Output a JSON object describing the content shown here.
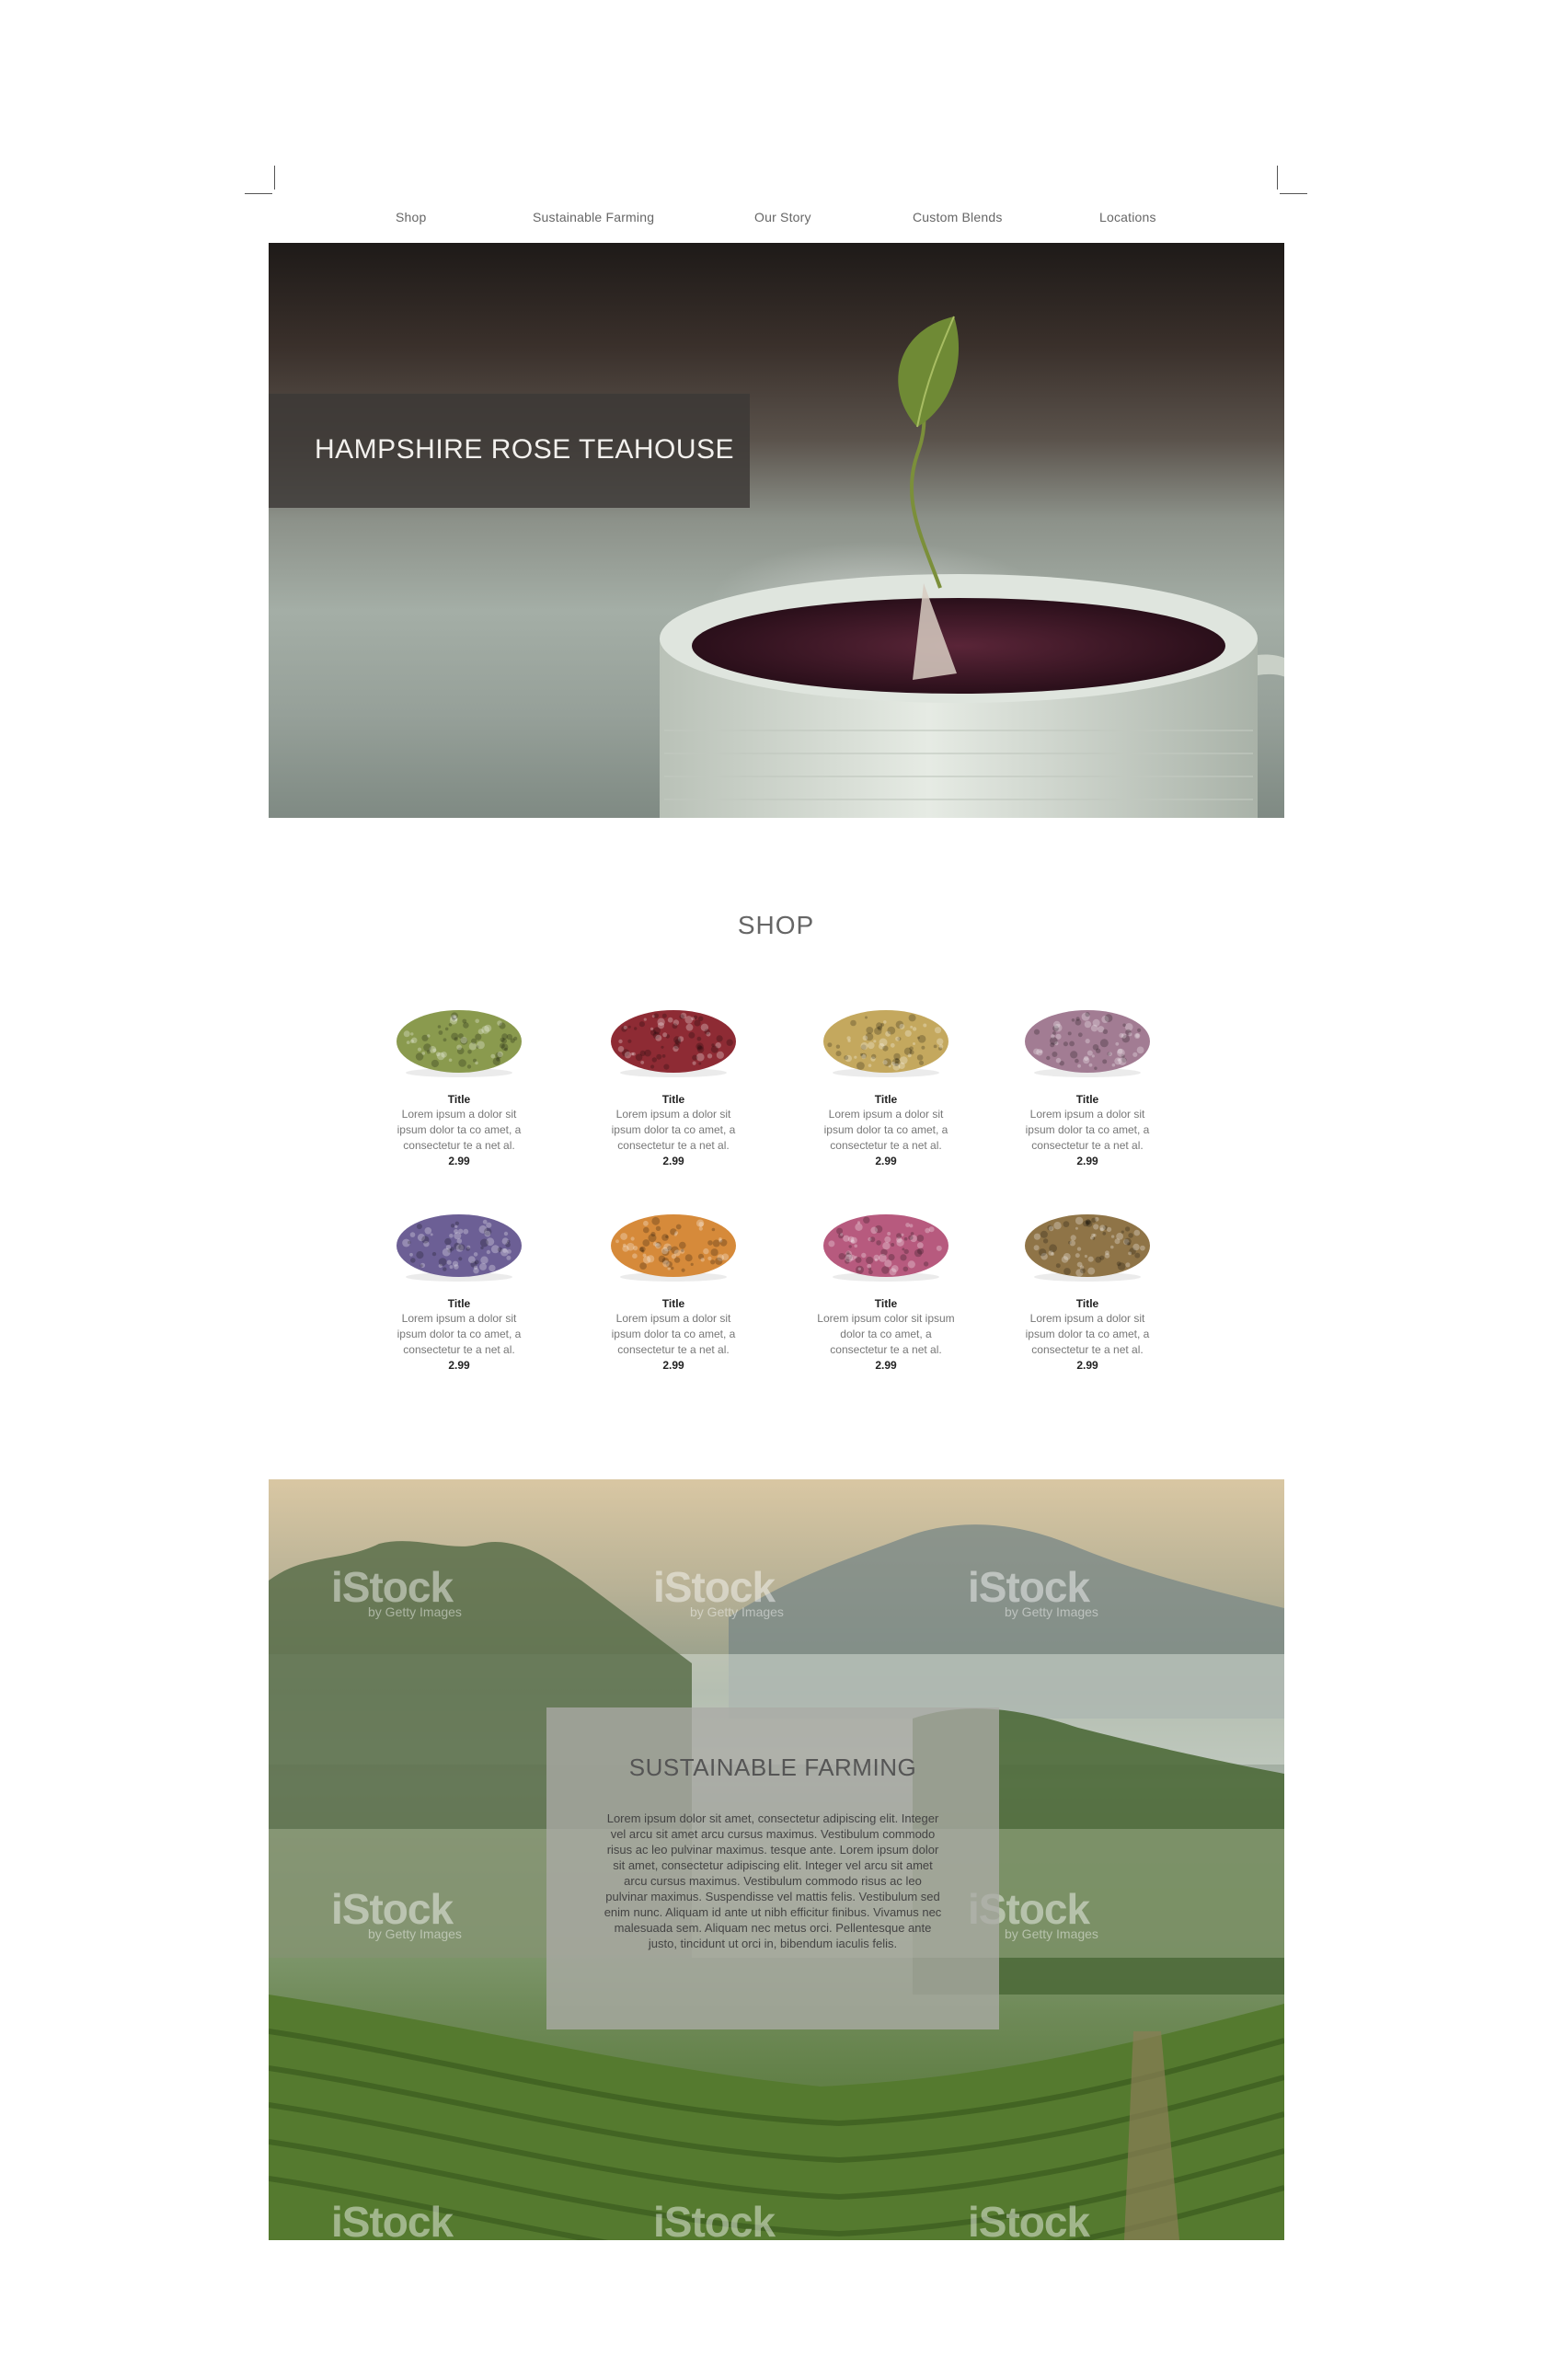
{
  "nav": {
    "items": [
      {
        "label": "Shop"
      },
      {
        "label": "Sustainable Farming"
      },
      {
        "label": "Our Story"
      },
      {
        "label": "Custom Blends"
      },
      {
        "label": "Locations"
      }
    ]
  },
  "hero": {
    "title": "HAMPSHIRE ROSE TEAHOUSE",
    "image": "tea-cup-with-leaf-tea-bag"
  },
  "shop": {
    "heading": "SHOP",
    "products": [
      {
        "title": "Title",
        "desc": "Lorem ipsum a dolor sit ipsum dolor ta co amet, a consectetur te a net al.",
        "price": "2.99",
        "image": "green-herb-pile",
        "color": "#8a9a4e"
      },
      {
        "title": "Title",
        "desc": "Lorem ipsum a dolor sit ipsum dolor ta co amet, a consectetur te a net al.",
        "price": "2.99",
        "image": "rose-petal-pile",
        "color": "#8e2b34"
      },
      {
        "title": "Title",
        "desc": "Lorem ipsum a dolor sit ipsum dolor ta co amet, a consectetur te a net al.",
        "price": "2.99",
        "image": "chamomile-pile",
        "color": "#c4a85e"
      },
      {
        "title": "Title",
        "desc": "Lorem ipsum a dolor sit ipsum dolor ta co amet, a consectetur te a net al.",
        "price": "2.99",
        "image": "heather-pile",
        "color": "#a27c93"
      },
      {
        "title": "Title",
        "desc": "Lorem ipsum a dolor sit ipsum dolor ta co amet, a consectetur te a net al.",
        "price": "2.99",
        "image": "lavender-pile",
        "color": "#6c5f95"
      },
      {
        "title": "Title",
        "desc": "Lorem ipsum a dolor sit ipsum dolor ta co amet, a consectetur te a net al.",
        "price": "2.99",
        "image": "calendula-pile",
        "color": "#d68a3a"
      },
      {
        "title": "Title",
        "desc": "Lorem ipsum color sit ipsum dolor ta co amet, a consectetur te a net al.",
        "price": "2.99",
        "image": "rosebud-pile",
        "color": "#b75a7e"
      },
      {
        "title": "Title",
        "desc": "Lorem ipsum a dolor sit ipsum dolor ta co amet, a consectetur te a net al.",
        "price": "2.99",
        "image": "seed-pile",
        "color": "#8f7447"
      }
    ]
  },
  "farming": {
    "heading": "SUSTAINABLE FARMING",
    "text": "Lorem ipsum dolor sit amet, consectetur adipiscing elit. Integer vel arcu sit amet arcu cursus maximus. Vestibulum commodo risus ac leo pulvinar maximus. tesque ante. Lorem ipsum dolor sit amet, consectetur adipiscing elit. Integer vel arcu sit amet arcu cursus maximus. Vestibulum commodo risus ac leo pulvinar maximus. Suspendisse vel mattis felis. Vestibulum sed enim nunc. Aliquam id ante ut nibh efficitur finibus. Vivamus nec malesuada sem. Aliquam nec metus orci. Pellentesque ante justo, tincidunt ut orci in, bibendum iaculis felis.",
    "image": "misty-tea-plantation",
    "watermark": "iStock",
    "watermark_sub": "by Getty Images"
  }
}
